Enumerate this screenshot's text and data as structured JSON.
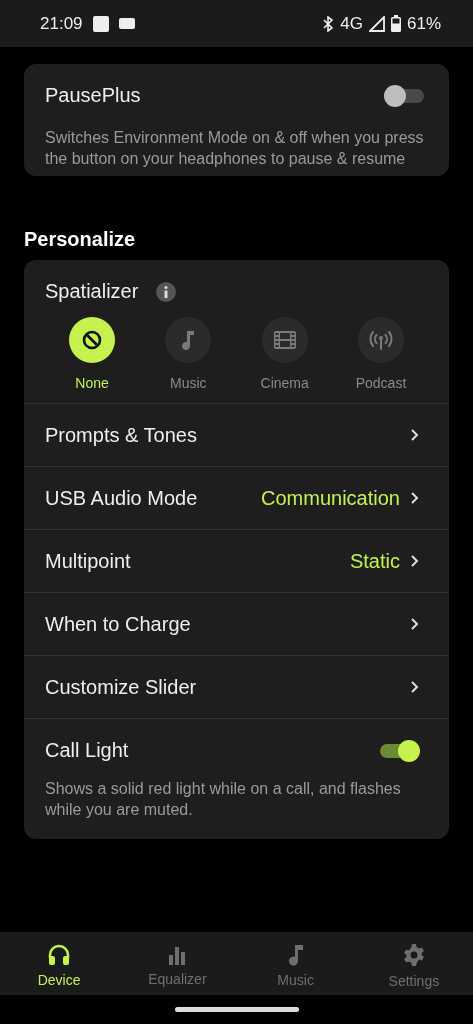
{
  "status_bar": {
    "time": "21:09",
    "network": "4G",
    "battery": "61%"
  },
  "pauseplus": {
    "title": "PausePlus",
    "on": false,
    "description": "Switches Environment Mode on & off when you press the button on your headphones to pause & resume"
  },
  "section_title": "Personalize",
  "spatializer": {
    "title": "Spatializer",
    "options": [
      {
        "label": "None",
        "kind": "none",
        "selected": true
      },
      {
        "label": "Music",
        "kind": "music",
        "selected": false
      },
      {
        "label": "Cinema",
        "kind": "cinema",
        "selected": false
      },
      {
        "label": "Podcast",
        "kind": "podcast",
        "selected": false
      }
    ]
  },
  "rows": [
    {
      "kind": "link",
      "label": "Prompts & Tones"
    },
    {
      "kind": "link",
      "label": "USB Audio Mode",
      "value": "Communication"
    },
    {
      "kind": "link",
      "label": "Multipoint",
      "value": "Static"
    },
    {
      "kind": "link",
      "label": "When to Charge"
    },
    {
      "kind": "link",
      "label": "Customize Slider"
    },
    {
      "kind": "toggle",
      "label": "Call Light",
      "on": true,
      "description": "Shows a solid red light while on a call, and flashes while you are muted."
    }
  ],
  "bottom_nav": [
    {
      "label": "Device",
      "kind": "headphones",
      "selected": true
    },
    {
      "label": "Equalizer",
      "kind": "equalizer",
      "selected": false
    },
    {
      "label": "Music",
      "kind": "music",
      "selected": false
    },
    {
      "label": "Settings",
      "kind": "settings",
      "selected": false
    }
  ]
}
